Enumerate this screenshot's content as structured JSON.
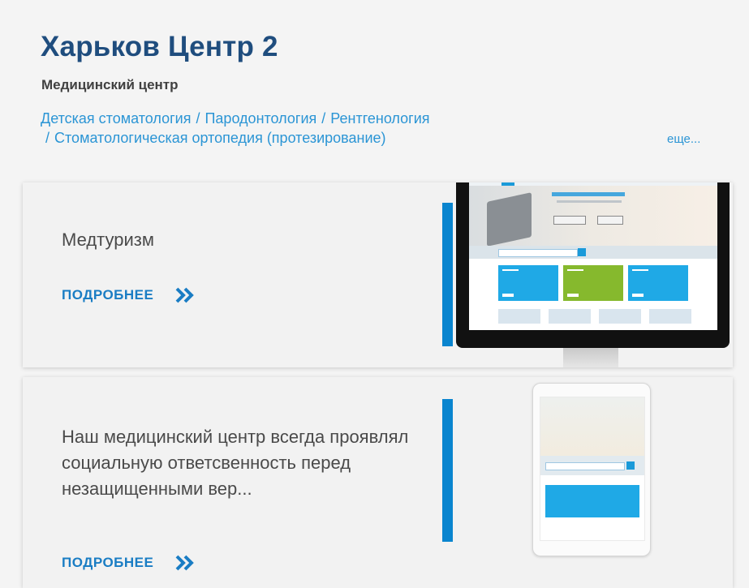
{
  "header": {
    "title": "Харьков Центр 2",
    "subtitle": "Медицинский центр",
    "tags": [
      "Детская стоматология",
      "Пародонтология",
      "Рентгенология",
      "Стоматологическая ортопедия (протезирование)"
    ],
    "tag_separator": "/",
    "more_link": "еще..."
  },
  "cards": [
    {
      "text": "Медтуризм",
      "more_label": "ПОДРОБНЕЕ",
      "image": "monitor-website-mockup"
    },
    {
      "text": "Наш медицинский центр всегда проявлял социальную ответсвенность перед незащищенными вер...",
      "more_label": "ПОДРОБНЕЕ",
      "image": "tablet-website-mockup"
    }
  ],
  "colors": {
    "title": "#1f4d7e",
    "link": "#2b95d5",
    "accent_bar": "#0a85cf",
    "button": "#1a7dc4",
    "background": "#f4f4f4"
  },
  "icons": [
    "double-chevron-right-icon"
  ]
}
